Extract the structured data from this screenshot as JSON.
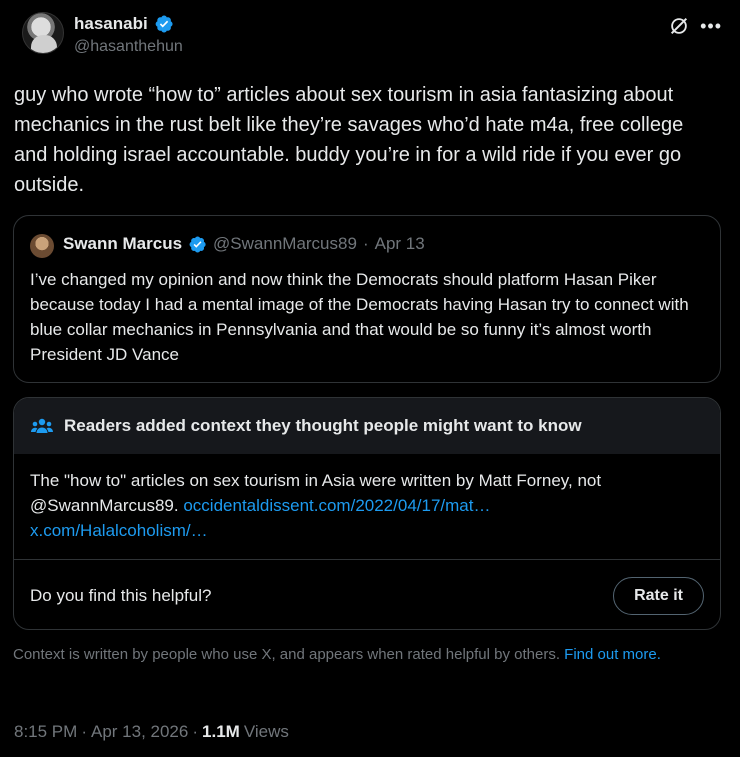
{
  "author": {
    "name": "hasanabi",
    "handle": "@hasanthehun"
  },
  "tweet": {
    "text": "guy who wrote “how to” articles about sex tourism in asia fantasizing about mechanics in the rust belt like they’re savages who’d hate m4a, free college and holding israel accountable. buddy you’re in for a wild ride if you ever go outside."
  },
  "quote": {
    "name": "Swann Marcus",
    "handle": "@SwannMarcus89",
    "separator": "·",
    "date": "Apr 13",
    "text": "I’ve changed my opinion and now think the Democrats should platform Hasan Piker because today I had a mental image of the Democrats having Hasan try to connect with blue collar mechanics in Pennsylvania and that would be so funny it’s almost worth President JD Vance"
  },
  "community_note": {
    "title": "Readers added context they thought people might want to know",
    "body": "The \"how to\" articles on sex tourism in Asia were written by Matt Forney, not @SwannMarcus89.",
    "link1": "occidentaldissent.com/2022/04/17/mat…",
    "link2": "x.com/Halalcoholism/…",
    "helpful_question": "Do you find this helpful?",
    "rate_label": "Rate it"
  },
  "context_footer": {
    "text": "Context is written by people who use X, and appears when rated helpful by others.",
    "link": "Find out more."
  },
  "meta": {
    "time": "8:15 PM",
    "sep1": "·",
    "date": "Apr 13, 2026",
    "sep2": "·",
    "views_count": "1.1M",
    "views_label": "Views"
  },
  "icons": {
    "verified": "verified-badge-icon",
    "grok": "grok-icon",
    "more": "more-options-icon",
    "people": "people-icon"
  },
  "colors": {
    "background": "#000000",
    "text": "#e7e9ea",
    "muted": "#71767b",
    "accent": "#1d9bf0",
    "border": "#2f3336"
  }
}
